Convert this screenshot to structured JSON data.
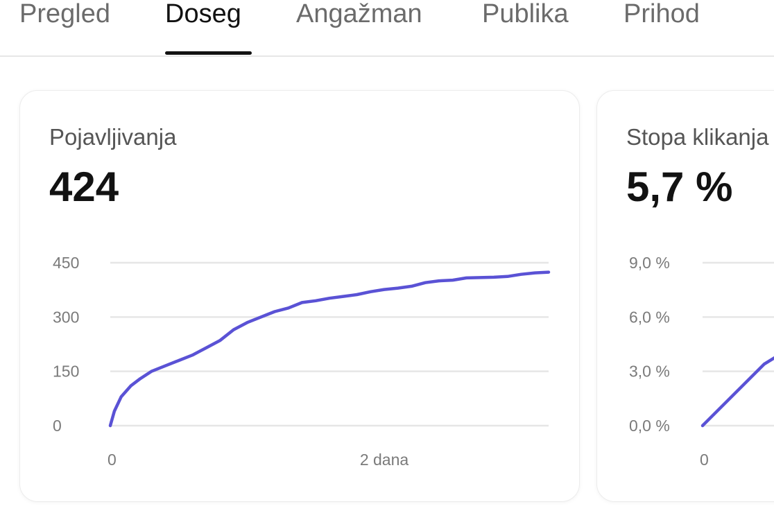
{
  "tabs": [
    {
      "label": "Pregled",
      "active": false
    },
    {
      "label": "Doseg",
      "active": true
    },
    {
      "label": "Angažman",
      "active": false
    },
    {
      "label": "Publika",
      "active": false
    },
    {
      "label": "Prihod",
      "active": false
    }
  ],
  "cards": [
    {
      "title": "Pojavljivanja",
      "value": "424"
    },
    {
      "title": "Stopa klikanja",
      "value": "5,7 %"
    }
  ],
  "colors": {
    "line": "#5a52d5",
    "grid": "#e6e6e6",
    "active_tab": "#121212",
    "inactive_tab": "#6b6b6b"
  },
  "chart_data": [
    {
      "type": "line",
      "title": "Pojavljivanja",
      "xlabel": "",
      "ylabel": "",
      "ylim": [
        0,
        450
      ],
      "yticks": [
        0,
        150,
        300,
        450
      ],
      "ytick_labels": [
        "0",
        "150",
        "300",
        "450"
      ],
      "xlim": [
        0,
        3.2
      ],
      "xtick_labels": [
        {
          "x": 0,
          "label": "0"
        },
        {
          "x": 2,
          "label": "2 dana"
        }
      ],
      "grid": true,
      "series": [
        {
          "values": [
            [
              0,
              0
            ],
            [
              0.03,
              40
            ],
            [
              0.08,
              80
            ],
            [
              0.15,
              110
            ],
            [
              0.22,
              130
            ],
            [
              0.3,
              150
            ],
            [
              0.4,
              165
            ],
            [
              0.5,
              180
            ],
            [
              0.6,
              195
            ],
            [
              0.7,
              215
            ],
            [
              0.8,
              235
            ],
            [
              0.9,
              265
            ],
            [
              1.0,
              285
            ],
            [
              1.1,
              300
            ],
            [
              1.2,
              315
            ],
            [
              1.3,
              325
            ],
            [
              1.4,
              340
            ],
            [
              1.5,
              345
            ],
            [
              1.6,
              352
            ],
            [
              1.7,
              357
            ],
            [
              1.8,
              362
            ],
            [
              1.9,
              370
            ],
            [
              2.0,
              376
            ],
            [
              2.1,
              380
            ],
            [
              2.2,
              385
            ],
            [
              2.3,
              395
            ],
            [
              2.4,
              400
            ],
            [
              2.5,
              402
            ],
            [
              2.6,
              408
            ],
            [
              2.7,
              409
            ],
            [
              2.8,
              410
            ],
            [
              2.9,
              412
            ],
            [
              3.0,
              418
            ],
            [
              3.1,
              422
            ],
            [
              3.2,
              424
            ]
          ]
        }
      ]
    },
    {
      "type": "line",
      "title": "Stopa klikanja",
      "xlabel": "",
      "ylabel": "",
      "ylim": [
        0,
        9
      ],
      "yticks": [
        0,
        3,
        6,
        9
      ],
      "ytick_labels": [
        "0,0 %",
        "3,0 %",
        "6,0 %",
        "9,0 %"
      ],
      "xlim": [
        0,
        3.2
      ],
      "xtick_labels": [
        {
          "x": 0,
          "label": "0"
        }
      ],
      "grid": true,
      "series": [
        {
          "values": [
            [
              0,
              0
            ],
            [
              0.45,
              3.4
            ],
            [
              0.9,
              5.5
            ]
          ]
        }
      ]
    }
  ]
}
